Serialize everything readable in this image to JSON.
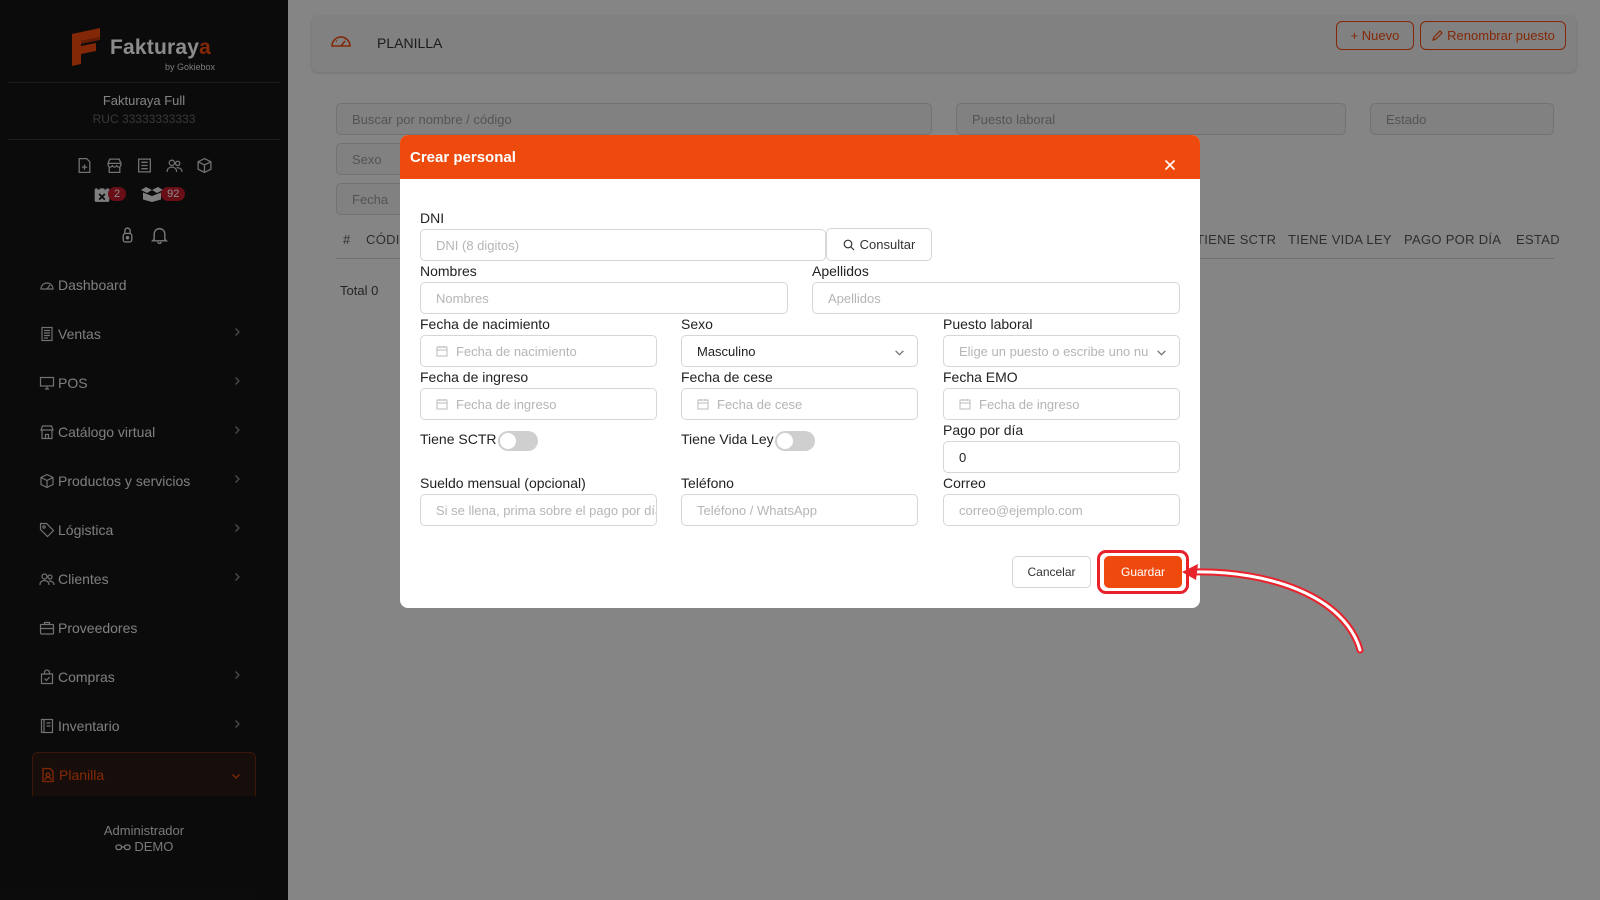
{
  "brand": {
    "name_main": "Fakturay",
    "name_accent": "a",
    "tagline": "by Gokiebox"
  },
  "company": {
    "name": "Fakturaya Full",
    "ruc": "RUC 33333333333"
  },
  "counters": {
    "calendar": "2",
    "boxes": "92"
  },
  "sidebar": {
    "items": [
      {
        "label": "Dashboard",
        "icon": "gauge-icon"
      },
      {
        "label": "Ventas",
        "icon": "receipt-icon"
      },
      {
        "label": "POS",
        "icon": "monitor-icon"
      },
      {
        "label": "Catálogo virtual",
        "icon": "store-icon"
      },
      {
        "label": "Productos y servicios",
        "icon": "box-icon"
      },
      {
        "label": "Lógistica",
        "icon": "tag-icon"
      },
      {
        "label": "Clientes",
        "icon": "users-icon"
      },
      {
        "label": "Proveedores",
        "icon": "briefcase-icon"
      },
      {
        "label": "Compras",
        "icon": "bag-icon"
      },
      {
        "label": "Inventario",
        "icon": "book-icon"
      },
      {
        "label": "Planilla",
        "icon": "document-user-icon"
      }
    ],
    "user_role": "Administrador",
    "user_name": "DEMO"
  },
  "header": {
    "title": "PLANILLA",
    "new_button": "+ Nuevo",
    "rename_button": "Renombrar puesto"
  },
  "filters": {
    "search_placeholder": "Buscar por nombre / código",
    "position_placeholder": "Puesto laboral",
    "status_placeholder": "Estado",
    "sex_placeholder": "Sexo",
    "date_placeholder": "Fecha"
  },
  "table": {
    "columns": [
      "#",
      "CÓDI",
      "TIENE SCTR",
      "TIENE VIDA LEY",
      "PAGO POR DÍA",
      "ESTAD"
    ],
    "total": "Total 0"
  },
  "modal": {
    "title": "Crear personal",
    "dni_label": "DNI",
    "dni_placeholder": "DNI (8 digitos)",
    "consult_button": "Consultar",
    "nombres_label": "Nombres",
    "nombres_placeholder": "Nombres",
    "apellidos_label": "Apellidos",
    "apellidos_placeholder": "Apellidos",
    "nacimiento_label": "Fecha de nacimiento",
    "nacimiento_placeholder": "Fecha de nacimiento",
    "sexo_label": "Sexo",
    "sexo_value": "Masculino",
    "puesto_label": "Puesto laboral",
    "puesto_placeholder": "Elige un puesto o escribe uno nuevo",
    "ingreso_label": "Fecha de ingreso",
    "ingreso_placeholder": "Fecha de ingreso",
    "cese_label": "Fecha de cese",
    "cese_placeholder": "Fecha de cese",
    "emo_label": "Fecha EMO",
    "emo_placeholder": "Fecha de ingreso",
    "sctr_label": "Tiene SCTR",
    "vidaley_label": "Tiene Vida Ley",
    "pago_label": "Pago por día",
    "pago_value": "0",
    "sueldo_label": "Sueldo mensual (opcional)",
    "sueldo_placeholder": "Si se llena, prima sobre el pago por día",
    "telefono_label": "Teléfono",
    "telefono_placeholder": "Teléfono / WhatsApp",
    "correo_label": "Correo",
    "correo_placeholder": "correo@ejemplo.com",
    "cancel_button": "Cancelar",
    "save_button": "Guardar"
  },
  "colors": {
    "accent": "#ef4a0e",
    "sidebar_bg": "#151515",
    "highlight": "#e8212b"
  }
}
